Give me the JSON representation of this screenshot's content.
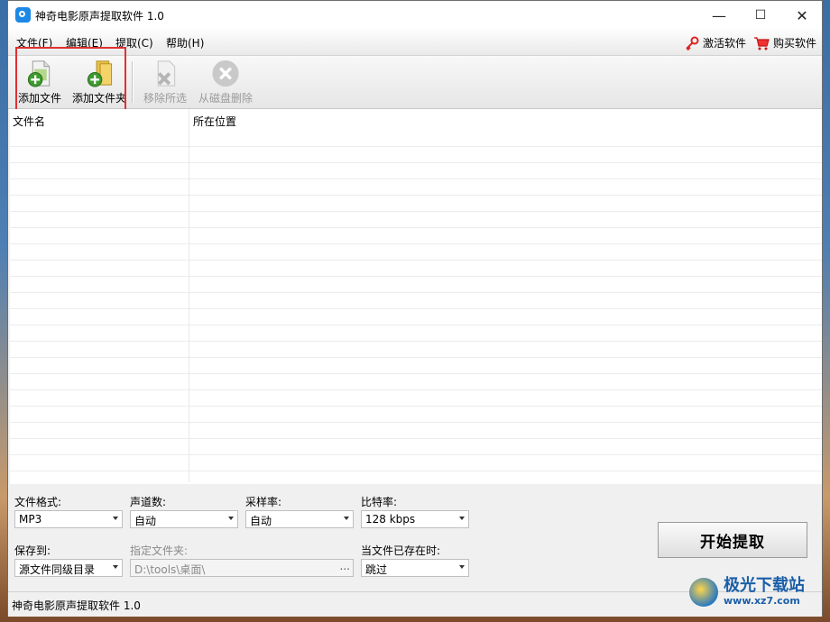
{
  "window": {
    "title": "神奇电影原声提取软件 1.0",
    "controls": [
      "—",
      "☐",
      "✕"
    ]
  },
  "menu": {
    "items": [
      "文件(F)",
      "编辑(E)",
      "提取(C)",
      "帮助(H)"
    ],
    "activate": "激活软件",
    "buy": "购买软件"
  },
  "toolbar": {
    "add_file": "添加文件",
    "add_folder": "添加文件夹",
    "remove_selected": "移除所选",
    "delete_from_disk": "从磁盘删除"
  },
  "list": {
    "col_name": "文件名",
    "col_location": "所在位置"
  },
  "options": {
    "format_label": "文件格式:",
    "format_value": "MP3",
    "channels_label": "声道数:",
    "channels_value": "自动",
    "samplerate_label": "采样率:",
    "samplerate_value": "自动",
    "bitrate_label": "比特率:",
    "bitrate_value": "128 kbps",
    "save_to_label": "保存到:",
    "save_to_value": "源文件同级目录",
    "folder_label": "指定文件夹:",
    "folder_value": "D:\\tools\\桌面\\",
    "folder_browse": "...",
    "exists_label": "当文件已存在时:",
    "exists_value": "跳过",
    "start_button": "开始提取"
  },
  "status": {
    "text": "神奇电影原声提取软件 1.0"
  },
  "watermark": {
    "name": "极光下载站",
    "url": "www.xz7.com"
  },
  "colors": {
    "highlight": "#e03030",
    "accent": "#1e88e5"
  }
}
